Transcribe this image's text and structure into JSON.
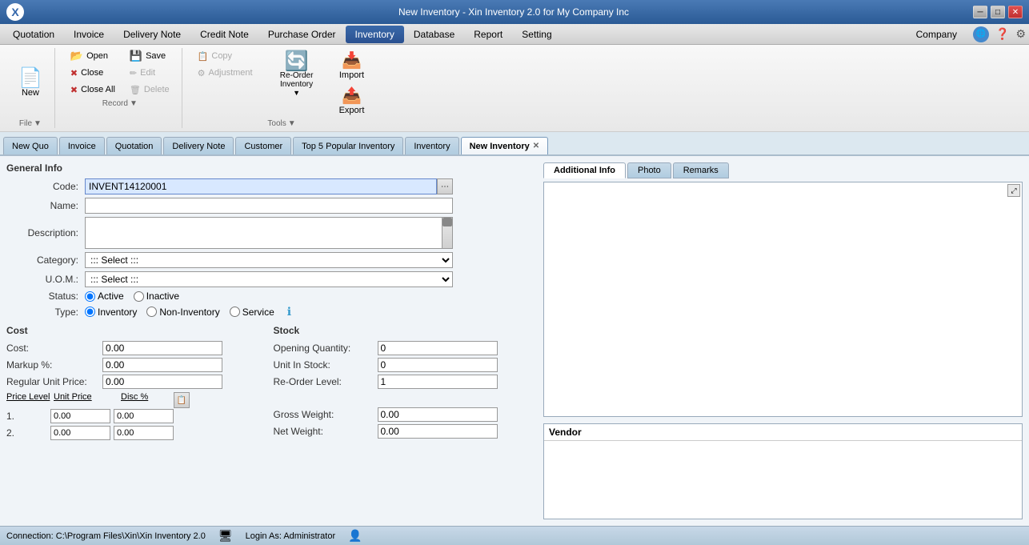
{
  "titleBar": {
    "title": "New Inventory - Xin Inventory 2.0 for My Company Inc",
    "minBtn": "─",
    "maxBtn": "□",
    "closeBtn": "✕"
  },
  "menuBar": {
    "items": [
      {
        "label": "Quotation",
        "active": false
      },
      {
        "label": "Invoice",
        "active": false
      },
      {
        "label": "Delivery Note",
        "active": false
      },
      {
        "label": "Credit Note",
        "active": false
      },
      {
        "label": "Purchase Order",
        "active": false
      },
      {
        "label": "Inventory",
        "active": true
      },
      {
        "label": "Database",
        "active": false
      },
      {
        "label": "Report",
        "active": false
      },
      {
        "label": "Setting",
        "active": false
      }
    ],
    "rightItems": [
      {
        "label": "Company"
      }
    ]
  },
  "toolbar": {
    "groups": [
      {
        "name": "file",
        "label": "File",
        "buttons": [
          {
            "label": "New",
            "icon": "📄",
            "type": "large"
          }
        ]
      },
      {
        "name": "record",
        "label": "Record",
        "buttons": [
          {
            "label": "Open",
            "icon": "📂",
            "type": "small"
          },
          {
            "label": "Close",
            "icon": "✖",
            "type": "small"
          },
          {
            "label": "Close All",
            "icon": "✖✖",
            "type": "small"
          },
          {
            "label": "Save",
            "icon": "💾",
            "type": "small"
          },
          {
            "label": "Edit",
            "icon": "✏",
            "type": "small",
            "disabled": true
          },
          {
            "label": "Delete",
            "icon": "🗑",
            "type": "small",
            "disabled": true
          }
        ]
      },
      {
        "name": "tools",
        "label": "Tools",
        "buttons": [
          {
            "label": "Copy",
            "icon": "📋",
            "type": "small",
            "disabled": true
          },
          {
            "label": "Adjustment",
            "icon": "⚙",
            "type": "small",
            "disabled": true
          },
          {
            "label": "Re-Order Inventory",
            "icon": "🔄",
            "type": "large"
          },
          {
            "label": "Import",
            "icon": "📥",
            "type": "medium"
          },
          {
            "label": "Export",
            "icon": "📤",
            "type": "medium"
          }
        ]
      }
    ]
  },
  "tabs": [
    {
      "label": "New Quo",
      "active": false,
      "closeable": false
    },
    {
      "label": "Invoice",
      "active": false,
      "closeable": false
    },
    {
      "label": "Quotation",
      "active": false,
      "closeable": false
    },
    {
      "label": "Delivery Note",
      "active": false,
      "closeable": false
    },
    {
      "label": "Customer",
      "active": false,
      "closeable": false
    },
    {
      "label": "Top 5 Popular Inventory",
      "active": false,
      "closeable": false
    },
    {
      "label": "Inventory",
      "active": false,
      "closeable": false
    },
    {
      "label": "New Inventory",
      "active": true,
      "closeable": true
    }
  ],
  "form": {
    "sectionTitle": "General Info",
    "fields": {
      "codeLabel": "Code:",
      "codeValue": "INVENT14120001",
      "nameLabel": "Name:",
      "nameValue": "",
      "descLabel": "Description:",
      "descValue": "",
      "categoryLabel": "Category:",
      "categoryPlaceholder": "::: Select :::",
      "uomLabel": "U.O.M.:",
      "uomPlaceholder": "::: Select :::",
      "statusLabel": "Status:",
      "statusActive": "Active",
      "statusInactive": "Inactive",
      "typeLabel": "Type:",
      "typeInventory": "Inventory",
      "typeNonInventory": "Non-Inventory",
      "typeService": "Service"
    }
  },
  "cost": {
    "sectionTitle": "Cost",
    "fields": [
      {
        "label": "Cost:",
        "value": "0.00"
      },
      {
        "label": "Markup %:",
        "value": "0.00"
      },
      {
        "label": "Regular Unit Price:",
        "value": "0.00"
      }
    ],
    "priceLevel": {
      "headers": [
        "Price Level",
        "Unit Price",
        "Disc %"
      ],
      "rows": [
        {
          "level": "1.",
          "unitPrice": "0.00",
          "disc": "0.00"
        },
        {
          "level": "2.",
          "unitPrice": "0.00",
          "disc": "0.00"
        }
      ]
    }
  },
  "stock": {
    "sectionTitle": "Stock",
    "fields": [
      {
        "label": "Opening Quantity:",
        "value": "0"
      },
      {
        "label": "Unit In Stock:",
        "value": "0"
      },
      {
        "label": "Re-Order Level:",
        "value": "1"
      },
      {
        "label": "Gross Weight:",
        "value": "0.00"
      },
      {
        "label": "Net Weight:",
        "value": "0.00"
      }
    ]
  },
  "rightPanel": {
    "tabs": [
      {
        "label": "Additional Info",
        "active": true
      },
      {
        "label": "Photo",
        "active": false
      },
      {
        "label": "Remarks",
        "active": false
      }
    ],
    "vendorLabel": "Vendor"
  },
  "statusBar": {
    "connectionText": "Connection: C:\\Program Files\\Xin\\Xin Inventory 2.0",
    "loginText": "Login As: Administrator"
  }
}
